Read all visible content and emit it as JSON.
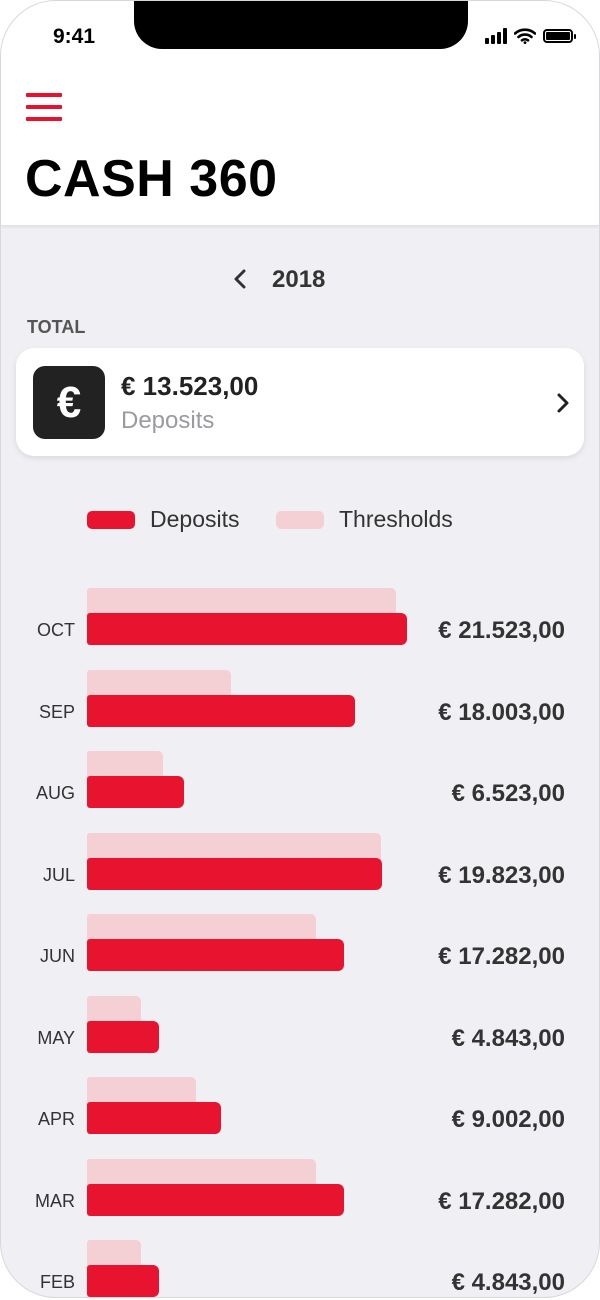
{
  "status_bar": {
    "time": "9:41"
  },
  "header": {
    "title": "CASH 360"
  },
  "year_nav": {
    "year": "2018",
    "prev_icon": "chevron-left-icon"
  },
  "total": {
    "label": "TOTAL",
    "amount": "€ 13.523,00",
    "subtitle": "Deposits",
    "icon_symbol": "€",
    "chevron_icon": "chevron-right-icon"
  },
  "legend": [
    {
      "label": "Deposits",
      "color": "#e8132f"
    },
    {
      "label": "Thresholds",
      "color": "#f4cfd4"
    }
  ],
  "colors": {
    "accent": "#e8112d",
    "deposit": "#e8132f",
    "threshold": "#f4cfd4"
  },
  "chart_data": {
    "type": "bar",
    "orientation": "horizontal",
    "categories": [
      "OCT",
      "SEP",
      "AUG",
      "JUL",
      "JUN",
      "MAY",
      "APR",
      "MAR",
      "FEB"
    ],
    "value_labels": [
      "€ 21.523,00",
      "€ 18.003,00",
      "€ 6.523,00",
      "€ 19.823,00",
      "€ 17.282,00",
      "€ 4.843,00",
      "€ 9.002,00",
      "€ 17.282,00",
      "€ 4.843,00"
    ],
    "series": [
      {
        "name": "Deposits",
        "values": [
          21523,
          18003,
          6523,
          19823,
          17282,
          4843,
          9002,
          17282,
          4843
        ]
      },
      {
        "name": "Thresholds",
        "values": [
          20800,
          9700,
          5100,
          19800,
          15400,
          3600,
          7300,
          15400,
          3600
        ]
      }
    ],
    "xlim": [
      0,
      21523
    ]
  }
}
